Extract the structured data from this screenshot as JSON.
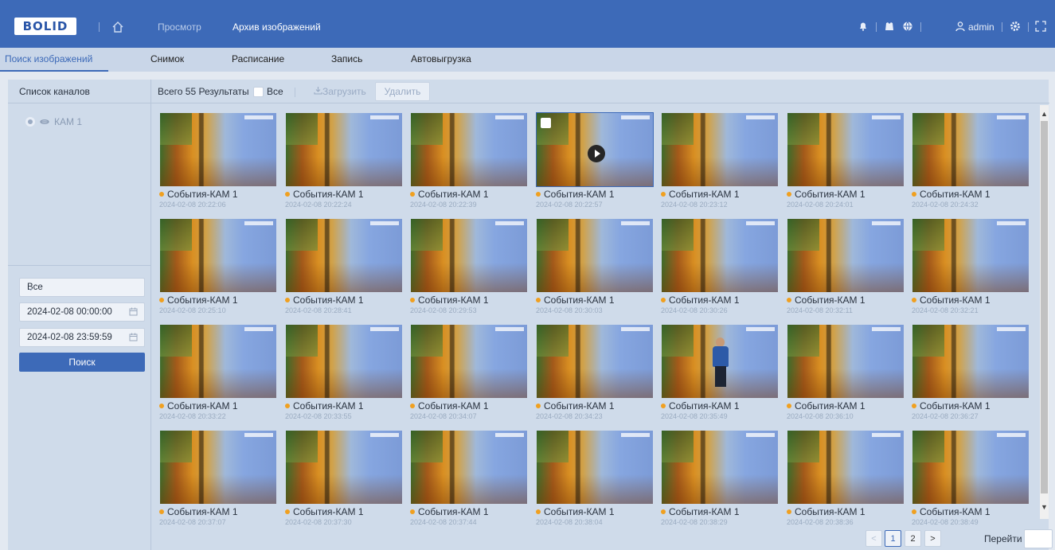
{
  "header": {
    "logo": "BOLID",
    "nav_view": "Просмотр",
    "nav_archive": "Архив изображений",
    "user": "admin"
  },
  "subnav": {
    "tabs": [
      "Поиск изображений",
      "Снимок",
      "Расписание",
      "Запись",
      "Автовыгрузка"
    ],
    "active": "Поиск изображений"
  },
  "left": {
    "title": "Список каналов",
    "channel": "КАМ 1",
    "type_select": "Все",
    "start": "2024-02-08 00:00:00",
    "end": "2024-02-08 23:59:59",
    "search_button": "Поиск"
  },
  "main": {
    "total": "Всего 55 Результаты",
    "select_all": "Все",
    "download": "Загрузить",
    "delete": "Удалить"
  },
  "tiles": [
    {
      "label": "События-КАМ 1",
      "time": "2024-02-08 20:22:06"
    },
    {
      "label": "События-КАМ 1",
      "time": "2024-02-08 20:22:24"
    },
    {
      "label": "События-КАМ 1",
      "time": "2024-02-08 20:22:39"
    },
    {
      "label": "События-КАМ 1",
      "time": "2024-02-08 20:22:57"
    },
    {
      "label": "События-КАМ 1",
      "time": "2024-02-08 20:23:12"
    },
    {
      "label": "События-КАМ 1",
      "time": "2024-02-08 20:24:01"
    },
    {
      "label": "События-КАМ 1",
      "time": "2024-02-08 20:24:32"
    },
    {
      "label": "События-КАМ 1",
      "time": "2024-02-08 20:25:10"
    },
    {
      "label": "События-КАМ 1",
      "time": "2024-02-08 20:28:41"
    },
    {
      "label": "События-КАМ 1",
      "time": "2024-02-08 20:29:53"
    },
    {
      "label": "События-КАМ 1",
      "time": "2024-02-08 20:30:03"
    },
    {
      "label": "События-КАМ 1",
      "time": "2024-02-08 20:30:26"
    },
    {
      "label": "События-КАМ 1",
      "time": "2024-02-08 20:32:11"
    },
    {
      "label": "События-КАМ 1",
      "time": "2024-02-08 20:32:21"
    },
    {
      "label": "События-КАМ 1",
      "time": "2024-02-08 20:33:22"
    },
    {
      "label": "События-КАМ 1",
      "time": "2024-02-08 20:33:55"
    },
    {
      "label": "События-КАМ 1",
      "time": "2024-02-08 20:34:07"
    },
    {
      "label": "События-КАМ 1",
      "time": "2024-02-08 20:34:23"
    },
    {
      "label": "События-КАМ 1",
      "time": "2024-02-08 20:35:49"
    },
    {
      "label": "События-КАМ 1",
      "time": "2024-02-08 20:36:10"
    },
    {
      "label": "События-КАМ 1",
      "time": "2024-02-08 20:36:27"
    },
    {
      "label": "События-КАМ 1",
      "time": "2024-02-08 20:37:07"
    },
    {
      "label": "События-КАМ 1",
      "time": "2024-02-08 20:37:30"
    },
    {
      "label": "События-КАМ 1",
      "time": "2024-02-08 20:37:44"
    },
    {
      "label": "События-КАМ 1",
      "time": "2024-02-08 20:38:04"
    },
    {
      "label": "События-КАМ 1",
      "time": "2024-02-08 20:38:29"
    },
    {
      "label": "События-КАМ 1",
      "time": "2024-02-08 20:38:36"
    },
    {
      "label": "События-КАМ 1",
      "time": "2024-02-08 20:38:49"
    }
  ],
  "pagination": {
    "prev": "<",
    "pages": [
      "1",
      "2"
    ],
    "current": "1",
    "next": ">",
    "goto": "Перейти"
  },
  "colors": {
    "topbar": "#3d6ab8",
    "accent": "#3d6ab8",
    "panel": "#cfdbea",
    "event_dot": "#f0a020"
  }
}
